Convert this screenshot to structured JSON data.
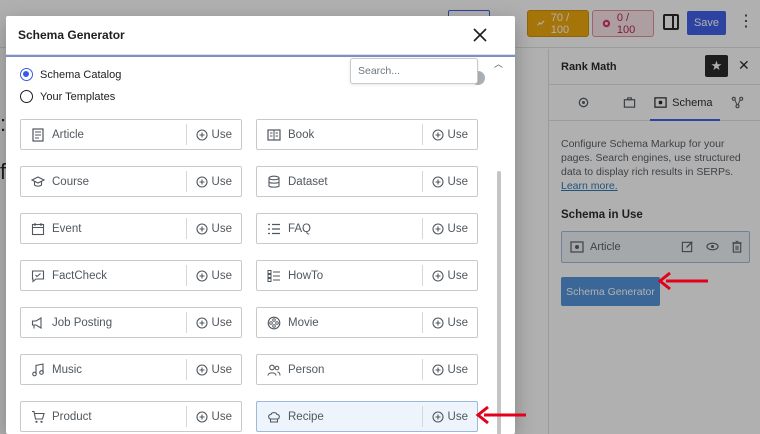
{
  "topbar": {
    "seo_score": "70 / 100",
    "content_score": "0 / 100",
    "save_label": "Save",
    "colors": {
      "seo_score_bg": "#f0a500",
      "content_score_bg": "#fbe4e9",
      "save_bg": "#3858e9"
    }
  },
  "sidebar": {
    "title": "Rank Math",
    "tabs": [
      {
        "icon": "gear-icon",
        "label": ""
      },
      {
        "icon": "briefcase-icon",
        "label": ""
      },
      {
        "icon": "schema-icon",
        "label": "Schema"
      },
      {
        "icon": "social-icon",
        "label": ""
      }
    ],
    "description": "Configure Schema Markup for your pages. Search engines, use structured data to display rich results in SERPs.",
    "learn_more": "Learn more.",
    "schema_in_use_heading": "Schema in Use",
    "schema_in_use_item": "Article",
    "generator_button": "Schema Generator"
  },
  "modal": {
    "title": "Schema Generator",
    "radio_options": [
      {
        "label": "Schema Catalog",
        "checked": true
      },
      {
        "label": "Your Templates",
        "checked": false
      }
    ],
    "search_placeholder": "Search...",
    "use_label": "Use",
    "schemas": [
      {
        "label": "Article",
        "icon": "article-icon"
      },
      {
        "label": "Book",
        "icon": "book-icon"
      },
      {
        "label": "Course",
        "icon": "course-icon"
      },
      {
        "label": "Dataset",
        "icon": "dataset-icon"
      },
      {
        "label": "Event",
        "icon": "event-icon"
      },
      {
        "label": "FAQ",
        "icon": "faq-icon"
      },
      {
        "label": "FactCheck",
        "icon": "factcheck-icon"
      },
      {
        "label": "HowTo",
        "icon": "howto-icon"
      },
      {
        "label": "Job Posting",
        "icon": "job-posting-icon"
      },
      {
        "label": "Movie",
        "icon": "movie-icon"
      },
      {
        "label": "Music",
        "icon": "music-icon"
      },
      {
        "label": "Person",
        "icon": "person-icon"
      },
      {
        "label": "Product",
        "icon": "product-icon"
      },
      {
        "label": "Recipe",
        "icon": "recipe-icon",
        "highlighted": true
      }
    ]
  },
  "annotations": {
    "arrow_color": "#e3001b"
  }
}
